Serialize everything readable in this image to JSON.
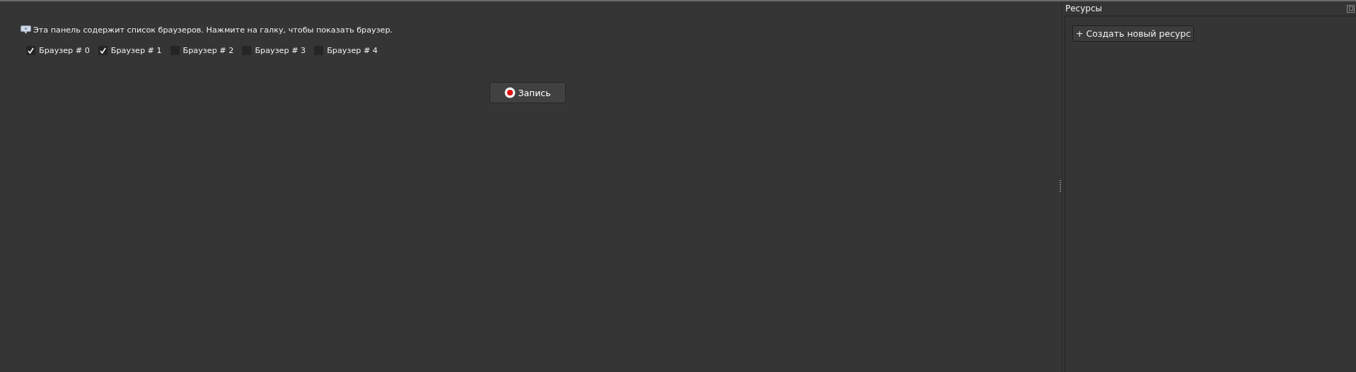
{
  "hint": "Эта панель содержит список браузеров. Нажмите на галку, чтобы показать браузер.",
  "browsers": [
    {
      "label": "Браузер # 0",
      "checked": true
    },
    {
      "label": "Браузер # 1",
      "checked": true
    },
    {
      "label": "Браузер # 2",
      "checked": false
    },
    {
      "label": "Браузер # 3",
      "checked": false
    },
    {
      "label": "Браузер # 4",
      "checked": false
    }
  ],
  "record_button": "Запись",
  "resources": {
    "title": "Ресурсы",
    "create_button": "+ Создать новый ресурс"
  }
}
